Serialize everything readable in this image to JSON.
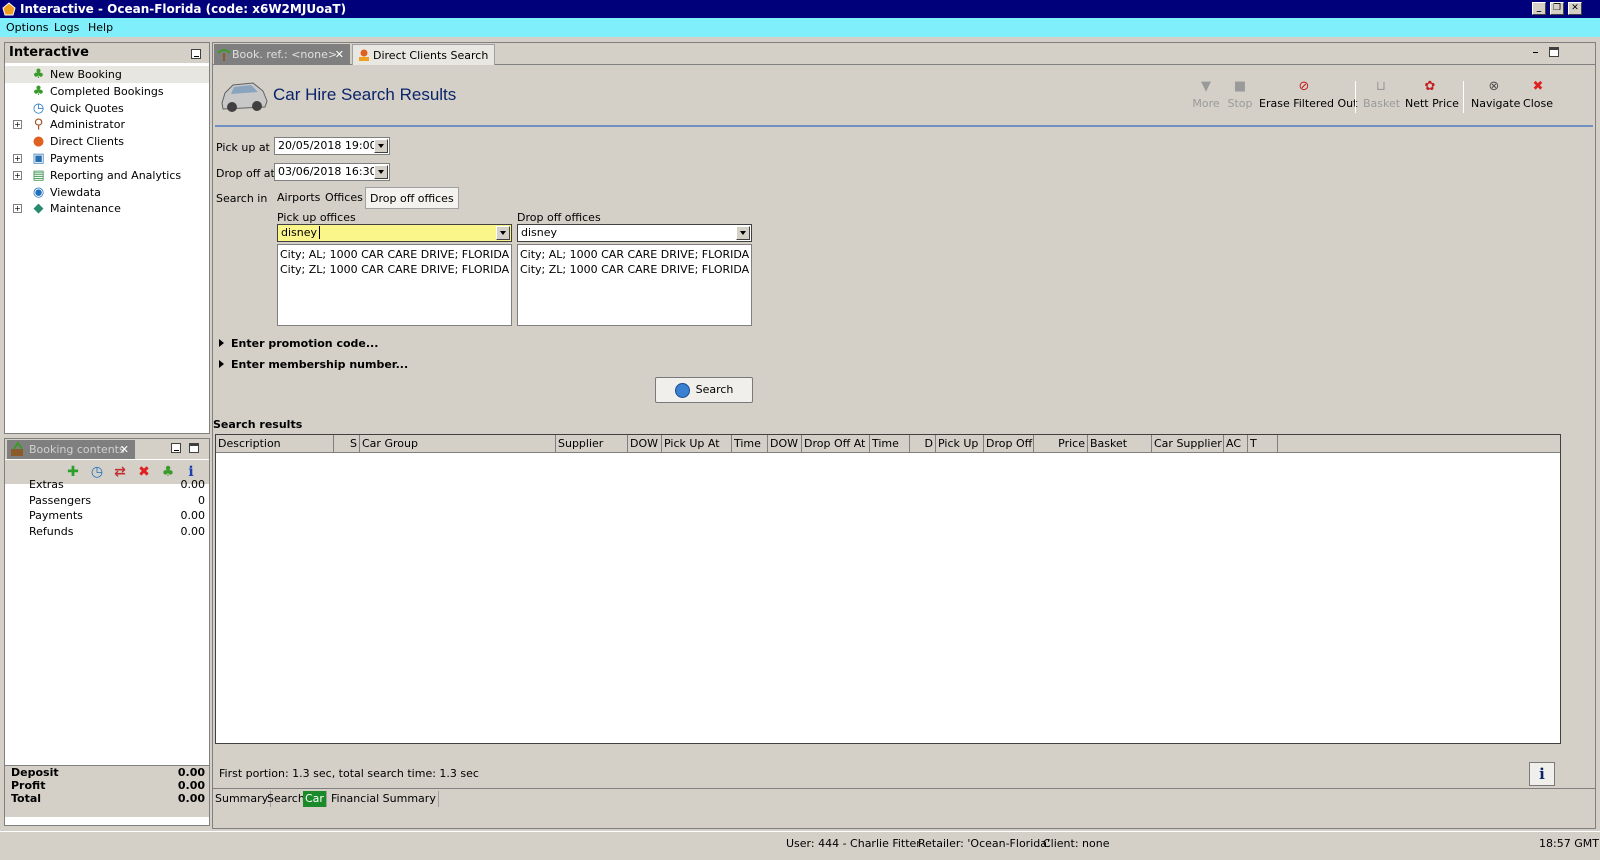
{
  "window": {
    "title": "Interactive - Ocean-Florida (code: x6W2MJUoaT)"
  },
  "menu": {
    "items": [
      "Options",
      "Logs",
      "Help"
    ]
  },
  "left_panel": {
    "title": "Interactive",
    "tree": [
      {
        "label": "New Booking",
        "icon": "palm-tree-icon",
        "expandable": false,
        "selected": true
      },
      {
        "label": "Completed Bookings",
        "icon": "palm-tree-icon",
        "expandable": false
      },
      {
        "label": "Quick Quotes",
        "icon": "clock-icon",
        "expandable": false
      },
      {
        "label": "Administrator",
        "icon": "person-icon",
        "expandable": true
      },
      {
        "label": "Direct Clients",
        "icon": "clients-icon",
        "expandable": false
      },
      {
        "label": "Payments",
        "icon": "payments-icon",
        "expandable": true
      },
      {
        "label": "Reporting and Analytics",
        "icon": "report-icon",
        "expandable": true
      },
      {
        "label": "Viewdata",
        "icon": "globe-icon",
        "expandable": false
      },
      {
        "label": "Maintenance",
        "icon": "maintenance-icon",
        "expandable": true
      }
    ]
  },
  "booking_contents": {
    "tab_label": "Booking contents",
    "rows": [
      {
        "label": "Extras",
        "value": "0.00"
      },
      {
        "label": "Passengers",
        "value": "0"
      },
      {
        "label": "Payments",
        "value": "0.00"
      },
      {
        "label": "Refunds",
        "value": "0.00"
      }
    ],
    "totals": [
      {
        "label": "Deposit",
        "value": "0.00"
      },
      {
        "label": "Profit",
        "value": "0.00"
      },
      {
        "label": "Total",
        "value": "0.00"
      }
    ]
  },
  "tabs": [
    {
      "label": "Book. ref.: <none>",
      "active": true
    },
    {
      "label": "Direct Clients Search",
      "active": false
    }
  ],
  "header": {
    "title": "Car Hire Search Results",
    "toolbar": [
      {
        "label": "More",
        "icon": "more-icon",
        "disabled": true
      },
      {
        "label": "Stop",
        "icon": "stop-icon",
        "disabled": true
      },
      {
        "label": "Erase Filtered Out",
        "icon": "erase-filter-icon",
        "disabled": false
      },
      {
        "label": "Basket",
        "icon": "basket-icon",
        "disabled": true
      },
      {
        "label": "Nett Price",
        "icon": "nett-price-icon",
        "disabled": false
      },
      {
        "label": "Navigate",
        "icon": "navigate-icon",
        "disabled": false
      },
      {
        "label": "Close",
        "icon": "close-icon",
        "disabled": false
      }
    ]
  },
  "form": {
    "pickup_label": "Pick up at",
    "pickup_value": "20/05/2018 19:00",
    "dropoff_label": "Drop off at",
    "dropoff_value": "03/06/2018 16:30",
    "search_in_label": "Search in",
    "search_in_tabs": [
      "Airports",
      "Offices",
      "Drop off offices"
    ],
    "pickup_offices_label": "Pick up offices",
    "pickup_offices_filter": "disney",
    "pickup_offices_list": [
      "City; AL; 1000 CAR CARE DRIVE; FLORIDA; ...",
      "City; ZL; 1000 CAR CARE DRIVE; FLORIDA; ..."
    ],
    "dropoff_offices_label": "Drop off offices",
    "dropoff_offices_filter": "disney",
    "dropoff_offices_list": [
      "City; AL; 1000 CAR CARE DRIVE; FLORIDA; ...",
      "City; ZL; 1000 CAR CARE DRIVE; FLORIDA; ..."
    ],
    "promo_link": "Enter promotion code...",
    "membership_link": "Enter membership number...",
    "search_button": "Search"
  },
  "results": {
    "title": "Search results",
    "columns": [
      "Description",
      "S",
      "Car Group",
      "Supplier",
      "DOW",
      "Pick Up At",
      "Time",
      "DOW",
      "Drop Off At",
      "Time",
      "D",
      "Pick Up",
      "Drop Off",
      "Price",
      "Basket",
      "Car Supplier",
      "AC",
      "T"
    ],
    "rows": []
  },
  "status_text": "First portion: 1.3 sec, total search time: 1.3 sec",
  "bottom_tabs": [
    {
      "label": "Summary",
      "selected": false
    },
    {
      "label": "Search",
      "selected": false
    },
    {
      "label": "Car",
      "selected": true
    },
    {
      "label": "Financial Summary",
      "selected": false
    }
  ],
  "statusbar": {
    "user": "User: 444 - Charlie Fitter",
    "retailer": "Retailer: 'Ocean-Florida'",
    "client": "Client: none",
    "time": "18:57 GMT"
  },
  "colors": {
    "titlebar": "#00007a",
    "menubar": "#7ff0fb",
    "accent_title": "#0a246a",
    "selected_tab": "#1a8a2a",
    "active_combo": "#fbf68a"
  }
}
